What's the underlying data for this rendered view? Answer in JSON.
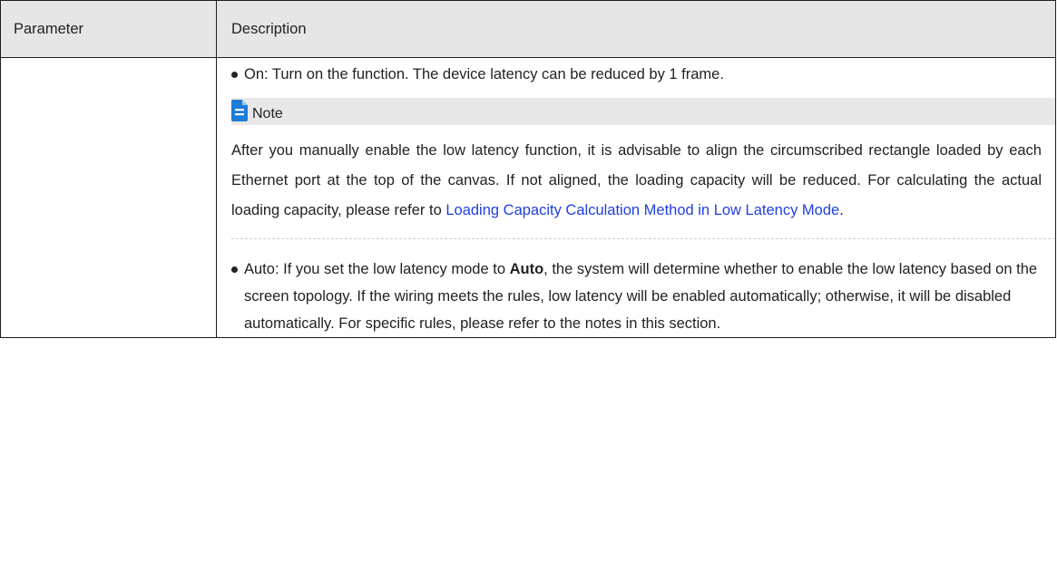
{
  "table": {
    "header": {
      "parameter": "Parameter",
      "description": "Description"
    },
    "row": {
      "parameter": "",
      "bullet_on": "On: Turn on the function. The device latency can be reduced by 1 frame.",
      "note": {
        "icon": "note-document-icon",
        "label": "Note",
        "text_before_link": "After you manually enable the low latency function, it is advisable to align the circumscribed rectangle loaded by each Ethernet port at the top of the canvas. If not aligned, the loading capacity will be reduced. For calculating the actual loading capacity, please refer to ",
        "link_text": "Loading Capacity Calculation Method in Low Latency Mode",
        "text_after_link": "."
      },
      "bullet_auto": {
        "prefix": "Auto: If you set the low latency mode to ",
        "bold": "Auto",
        "suffix": ", the system will determine whether to enable the low latency based on the screen topology. If the wiring meets the rules, low latency will be enabled automatically; otherwise, it will be disabled automatically. For specific rules, please refer to the notes in this section."
      }
    }
  },
  "colors": {
    "header_bg": "#e6e6e6",
    "note_bg": "#e8e8e8",
    "link": "#1f3fe0",
    "icon": "#1e7bd8"
  }
}
